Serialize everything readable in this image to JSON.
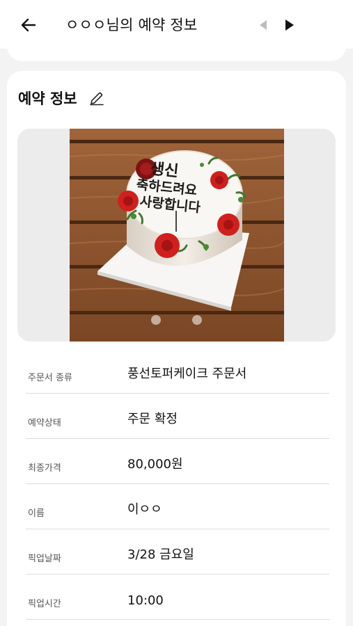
{
  "header": {
    "title": "ㅇㅇㅇ님의 예약 정보",
    "back_icon": "arrow-left-icon",
    "prev_icon": "triangle-left-icon",
    "next_icon": "triangle-right-icon"
  },
  "section": {
    "title": "예약 정보",
    "edit_icon": "pencil-icon"
  },
  "carousel": {
    "image": "cake-photo",
    "image_text": "생신 축하드려요 사랑합니다",
    "slide_count": 2,
    "active_slide": 1
  },
  "details": [
    {
      "label": "주문서 종류",
      "value": "풍선토퍼케이크 주문서"
    },
    {
      "label": "예약상태",
      "value": "주문 확정"
    },
    {
      "label": "최종가격",
      "value": "80,000원"
    },
    {
      "label": "이름",
      "value": "이ㅇㅇ"
    },
    {
      "label": "픽업날짜",
      "value": "3/28 금요일"
    },
    {
      "label": "픽업시간",
      "value": "10:00"
    }
  ]
}
